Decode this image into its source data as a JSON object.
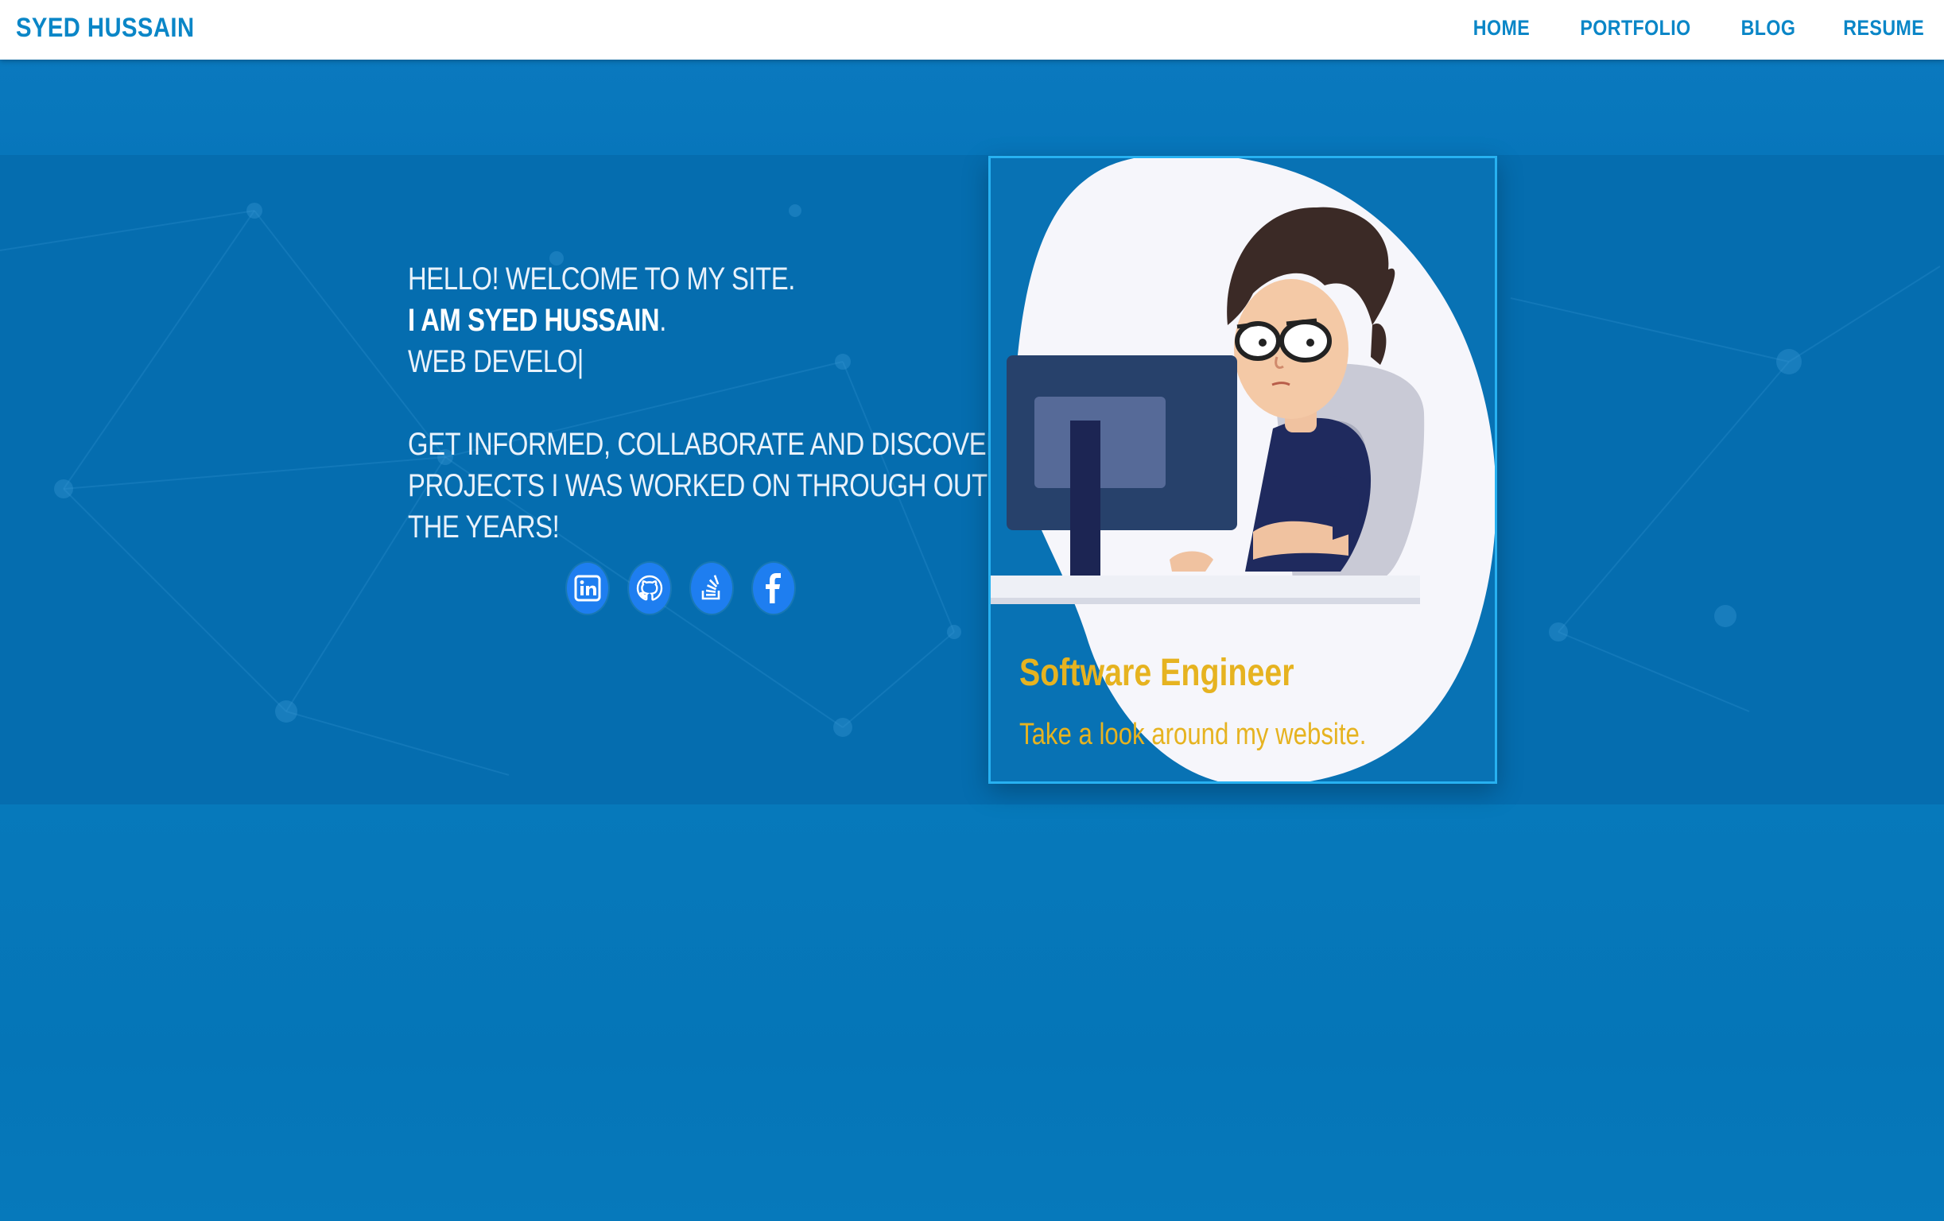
{
  "navbar": {
    "brand": "SYED HUSSAIN",
    "links": [
      {
        "label": "HOME"
      },
      {
        "label": "PORTFOLIO"
      },
      {
        "label": "BLOG"
      },
      {
        "label": "RESUME"
      }
    ]
  },
  "hero": {
    "greeting": "HELLO! WELCOME TO MY SITE.",
    "name_line": "I AM SYED HUSSAIN",
    "name_punct": ".",
    "typed_role": "WEB DEVELO|",
    "tagline_1": "GET INFORMED, COLLABORATE AND DISCOVER",
    "tagline_2": "PROJECTS I WAS WORKED ON THROUGH OUT",
    "tagline_3": "THE YEARS!",
    "social": [
      {
        "icon": "linkedin-icon"
      },
      {
        "icon": "github-icon"
      },
      {
        "icon": "stackoverflow-icon"
      },
      {
        "icon": "facebook-icon"
      }
    ]
  },
  "card": {
    "title": "Software Engineer",
    "subtitle": "Take a look around my website."
  },
  "colors": {
    "brand": "#0a86c7",
    "background": "#0679bb",
    "hero_band": "#056daf",
    "accent_gold": "#e6b320",
    "card_border": "#27b1f1",
    "social_button": "#1e7ef0"
  }
}
